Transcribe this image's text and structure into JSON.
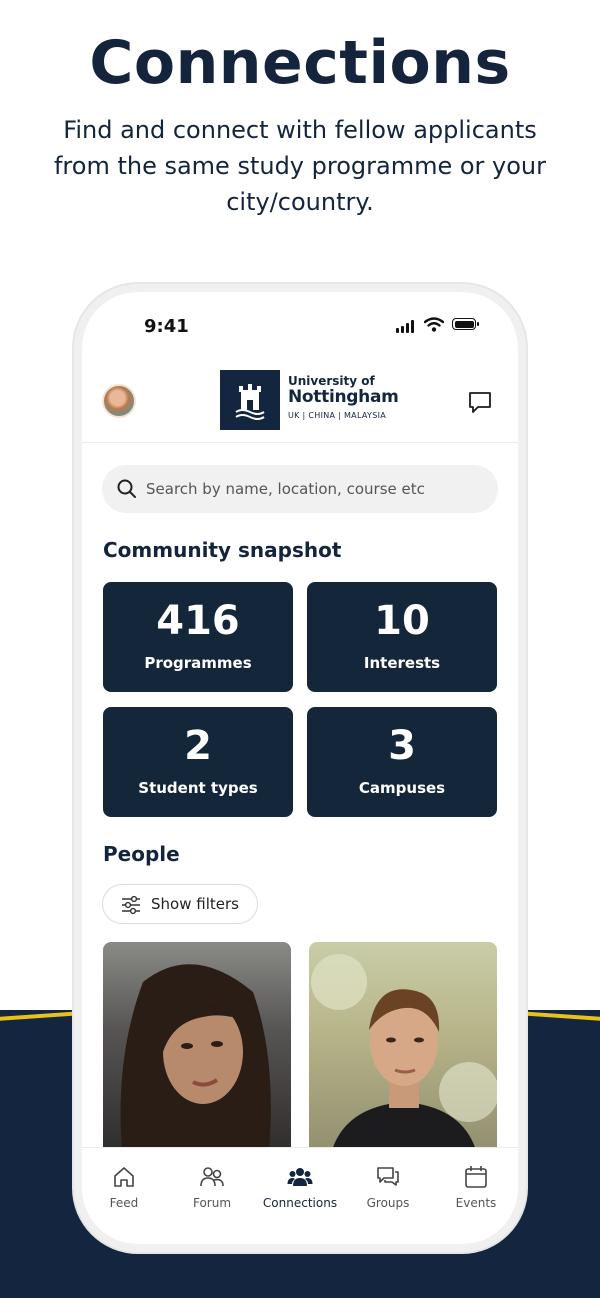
{
  "promo": {
    "title": "Connections",
    "subtitle": "Find and connect with fellow applicants from the same study programme or your city/country."
  },
  "status_bar": {
    "time": "9:41"
  },
  "header": {
    "logo_line1": "University of",
    "logo_line2": "Nottingham",
    "logo_line3": "UK | CHINA | MALAYSIA"
  },
  "search": {
    "placeholder": "Search by name, location, course etc"
  },
  "snapshot": {
    "title": "Community snapshot",
    "stats": [
      {
        "value": "416",
        "label": "Programmes"
      },
      {
        "value": "10",
        "label": "Interests"
      },
      {
        "value": "2",
        "label": "Student types"
      },
      {
        "value": "3",
        "label": "Campuses"
      }
    ]
  },
  "people": {
    "title": "People",
    "filters_label": "Show filters"
  },
  "tabs": [
    {
      "label": "Feed",
      "icon": "home-icon"
    },
    {
      "label": "Forum",
      "icon": "people-icon"
    },
    {
      "label": "Connections",
      "icon": "group-icon",
      "active": true
    },
    {
      "label": "Groups",
      "icon": "chat-bubbles-icon"
    },
    {
      "label": "Events",
      "icon": "calendar-icon"
    }
  ],
  "colors": {
    "navy": "#13253f",
    "tile": "#13263a",
    "accent_stripe": "#e8c11a"
  }
}
